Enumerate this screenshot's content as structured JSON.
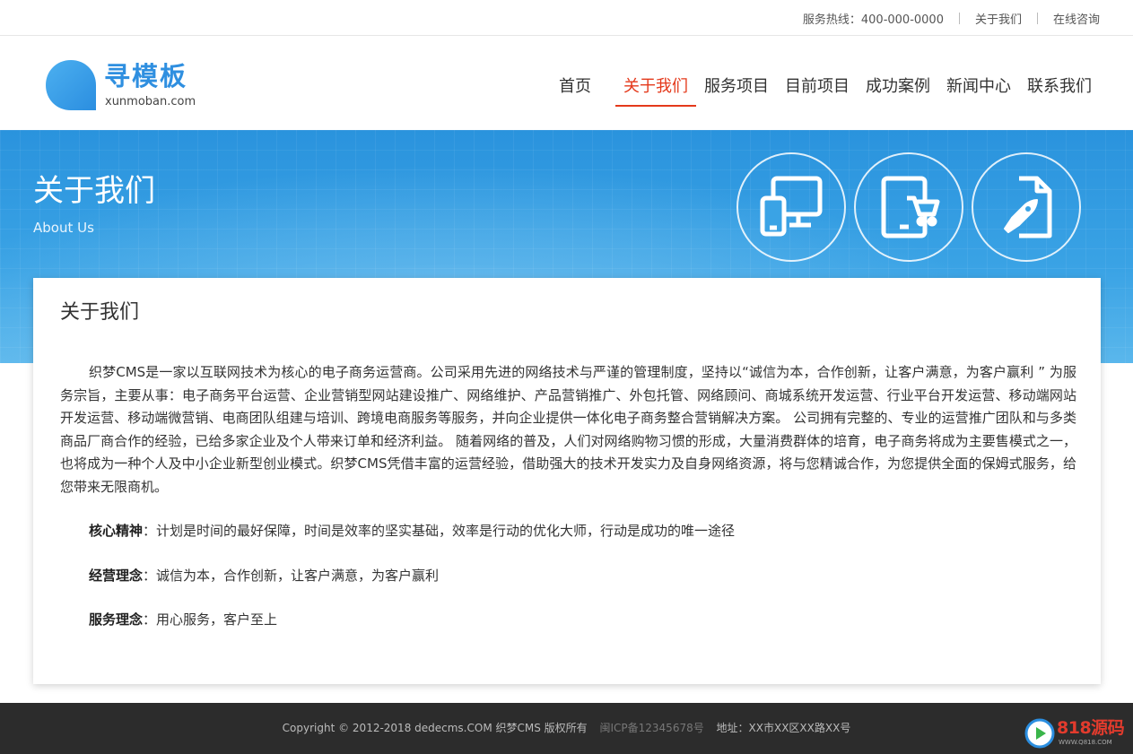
{
  "topbar": {
    "hotline": "服务热线：400-000-0000",
    "about_link": "关于我们",
    "consult_link": "在线咨询"
  },
  "logo": {
    "cn": "寻模板",
    "en": "xunmoban.com",
    "color": "#2f8fe0"
  },
  "nav": {
    "items": [
      {
        "label": "首页"
      },
      {
        "label": "关于我们",
        "active": true
      },
      {
        "label": "服务项目"
      },
      {
        "label": "目前项目"
      },
      {
        "label": "成功案例"
      },
      {
        "label": "新闻中心"
      },
      {
        "label": "联系我们"
      }
    ],
    "active_color": "#e4391b"
  },
  "banner": {
    "title": "关于我们",
    "subtitle": "About Us",
    "icons": [
      "devices-icon",
      "tablet-cart-icon",
      "rocket-document-icon"
    ]
  },
  "content": {
    "title": "关于我们",
    "paragraph": "织梦CMS是一家以互联网技术为核心的电子商务运营商。公司采用先进的网络技术与严谨的管理制度，坚持以“诚信为本，合作创新，让客户满意，为客户赢利 ” 为服务宗旨，主要从事：电子商务平台运营、企业营销型网站建设推广、网络维护、产品营销推广、外包托管、网络顾问、商城系统开发运营、行业平台开发运营、移动端网站开发运营、移动端微营销、电商团队组建与培训、跨境电商服务等服务，并向企业提供一体化电子商务整合营销解决方案。 公司拥有完整的、专业的运营推广团队和与多类商品厂商合作的经验，已给多家企业及个人带来订单和经济利益。 随着网络的普及，人们对网络购物习惯的形成，大量消费群体的培育，电子商务将成为主要售模式之一，也将成为一种个人及中小企业新型创业模式。织梦CMS凭借丰富的运营经验，借助强大的技术开发实力及自身网络资源，将与您精诚合作，为您提供全面的保姆式服务，给您带来无限商机。",
    "items": [
      {
        "label": "核心精神",
        "text": "：计划是时间的最好保障，时间是效率的坚实基础，效率是行动的优化大师，行动是成功的唯一途径"
      },
      {
        "label": "经营理念",
        "text": "：诚信为本，合作创新，让客户满意，为客户赢利"
      },
      {
        "label": "服务理念",
        "text": "：用心服务，客户至上"
      }
    ]
  },
  "footer": {
    "copyright": "Copyright © 2012-2018 dedecms.COM 织梦CMS 版权所有",
    "icp": "闽ICP备12345678号",
    "address": "地址：XX市XX区XX路XX号"
  },
  "watermark": {
    "num": "818源码",
    "url": "WWW.Q818.COM"
  }
}
